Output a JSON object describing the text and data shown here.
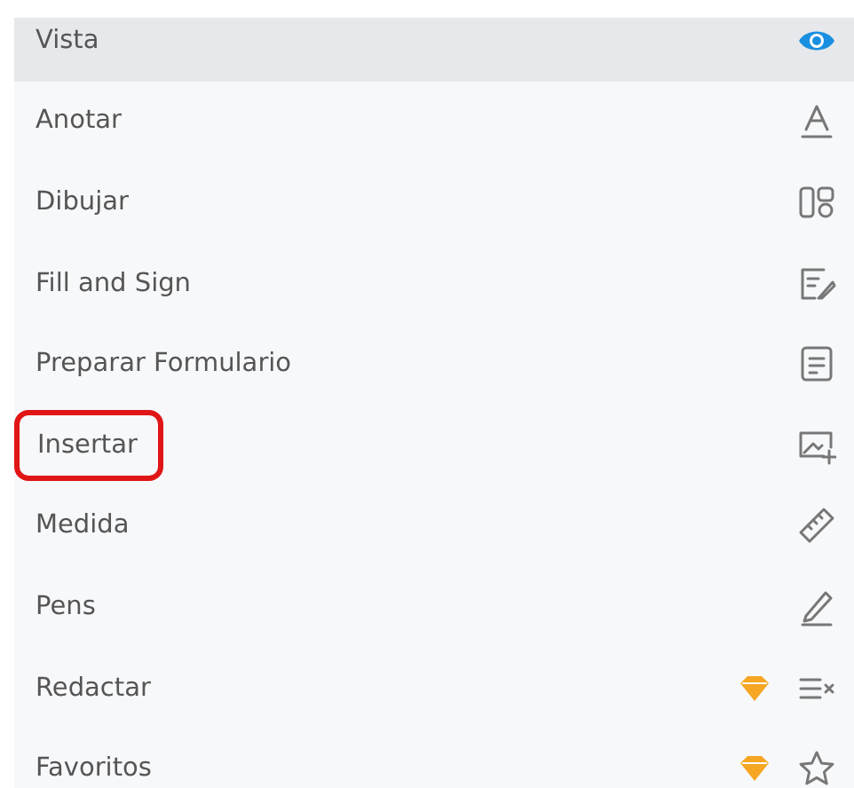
{
  "menu": [
    {
      "label": "Vista",
      "kind": "view",
      "selected": true,
      "premium": false,
      "highlighted": false
    },
    {
      "label": "Anotar",
      "kind": "annotate",
      "selected": false,
      "premium": false,
      "highlighted": false
    },
    {
      "label": "Dibujar",
      "kind": "draw",
      "selected": false,
      "premium": false,
      "highlighted": false
    },
    {
      "label": "Fill and Sign",
      "kind": "fillsign",
      "selected": false,
      "premium": false,
      "highlighted": false
    },
    {
      "label": "Preparar Formulario",
      "kind": "form",
      "selected": false,
      "premium": false,
      "highlighted": false
    },
    {
      "label": "Insertar",
      "kind": "insert",
      "selected": false,
      "premium": false,
      "highlighted": true
    },
    {
      "label": "Medida",
      "kind": "measure",
      "selected": false,
      "premium": false,
      "highlighted": false
    },
    {
      "label": "Pens",
      "kind": "pens",
      "selected": false,
      "premium": false,
      "highlighted": false
    },
    {
      "label": "Redactar",
      "kind": "redact",
      "selected": false,
      "premium": true,
      "highlighted": false
    },
    {
      "label": "Favoritos",
      "kind": "favorites",
      "selected": false,
      "premium": true,
      "highlighted": false
    }
  ]
}
